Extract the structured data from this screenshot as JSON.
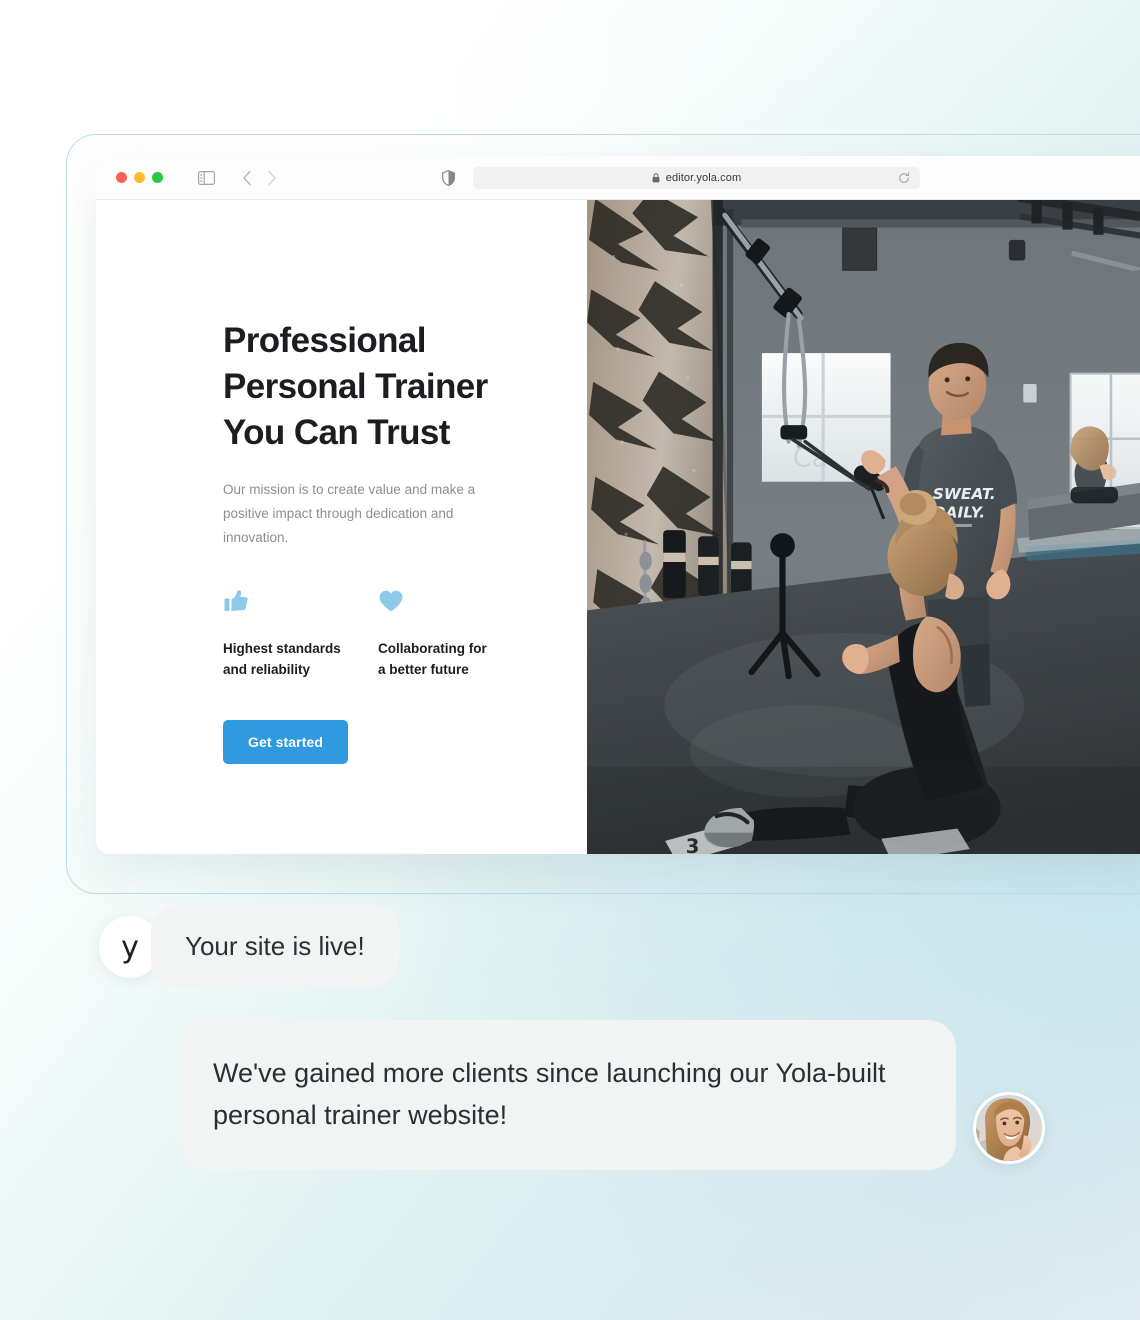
{
  "browser": {
    "traffic_lights": [
      "close",
      "minimize",
      "maximize"
    ],
    "sidebar_toggle": "sidebar-toggle-icon",
    "back": "chevron-left-icon",
    "forward": "chevron-right-icon",
    "shield": "shield-icon",
    "lock": "lock-icon",
    "url": "editor.yola.com",
    "reload": "reload-icon"
  },
  "site": {
    "headline": "Professional\nPersonal Trainer\nYou Can Trust",
    "subtext": "Our mission is to create value and make a positive impact through dedication and innovation.",
    "features": [
      {
        "icon": "thumbs-up-icon",
        "label": "Highest standards\nand reliability"
      },
      {
        "icon": "heart-icon",
        "label": "Collaborating for\na better future"
      }
    ],
    "cta_label": "Get started",
    "photo_alt": "gym personal trainer with client stretching on floor"
  },
  "chat": {
    "logo_letter": "y",
    "message_1": "Your site is live!",
    "message_2": "We've gained more clients since launching our Yola-built personal trainer website!",
    "client_avatar": "smiling-woman-photo"
  },
  "colors": {
    "accent_blue": "#2f9ae0",
    "icon_blue": "#8ec8ea",
    "bubble_gray": "#f2f4f4",
    "frame_border": "#b9dcef",
    "heading": "#1b1d21",
    "muted_text": "#8a8f96"
  }
}
